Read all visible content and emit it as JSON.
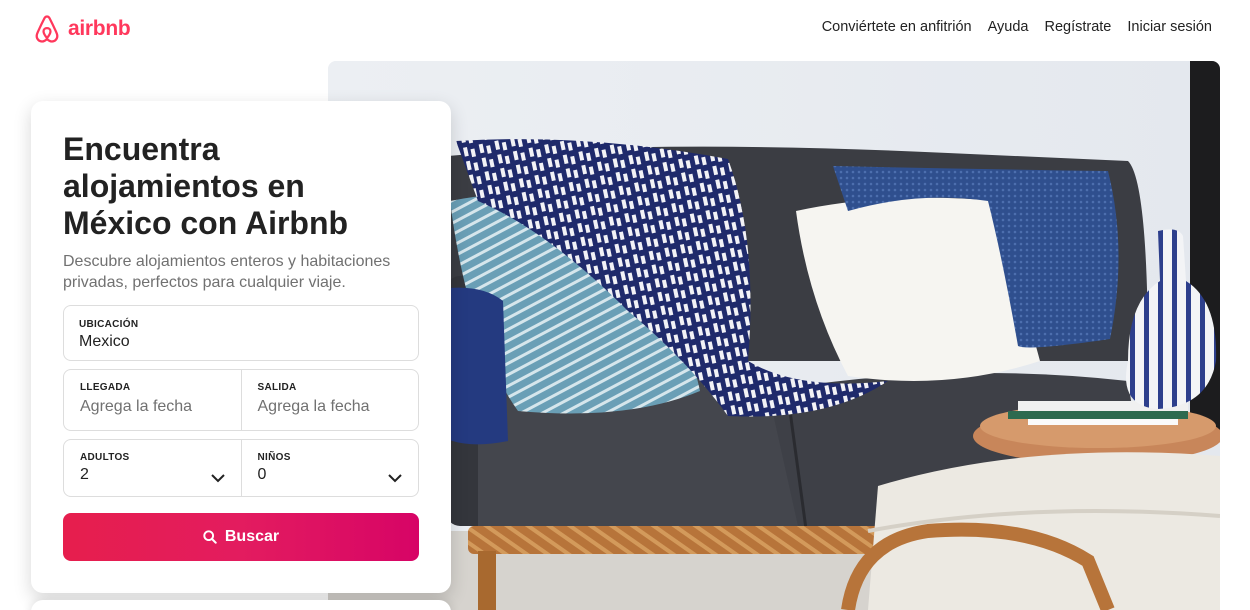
{
  "brand": {
    "name": "airbnb",
    "color": "#ff385c",
    "icon": "airbnb-belo-icon"
  },
  "nav": {
    "host": "Conviértete en anfitrión",
    "help": "Ayuda",
    "signup": "Regístrate",
    "login": "Iniciar sesión"
  },
  "card": {
    "title": "Encuentra alojamientos en México con Airbnb",
    "subtitle": "Descubre alojamientos enteros y habitaciones privadas, perfectos para cualquier viaje."
  },
  "search": {
    "location": {
      "label": "UBICACIÓN",
      "value": "Mexico"
    },
    "checkin": {
      "label": "LLEGADA",
      "placeholder": "Agrega la fecha"
    },
    "checkout": {
      "label": "SALIDA",
      "placeholder": "Agrega la fecha"
    },
    "adults": {
      "label": "ADULTOS",
      "value": "2"
    },
    "children": {
      "label": "NIÑOS",
      "value": "0"
    },
    "button_label": "Buscar",
    "button_icon": "search-icon",
    "button_colors": [
      "#e61e4d",
      "#e31c5f",
      "#d70466"
    ]
  },
  "hero": {
    "image": "living-room-sofa-photo"
  }
}
